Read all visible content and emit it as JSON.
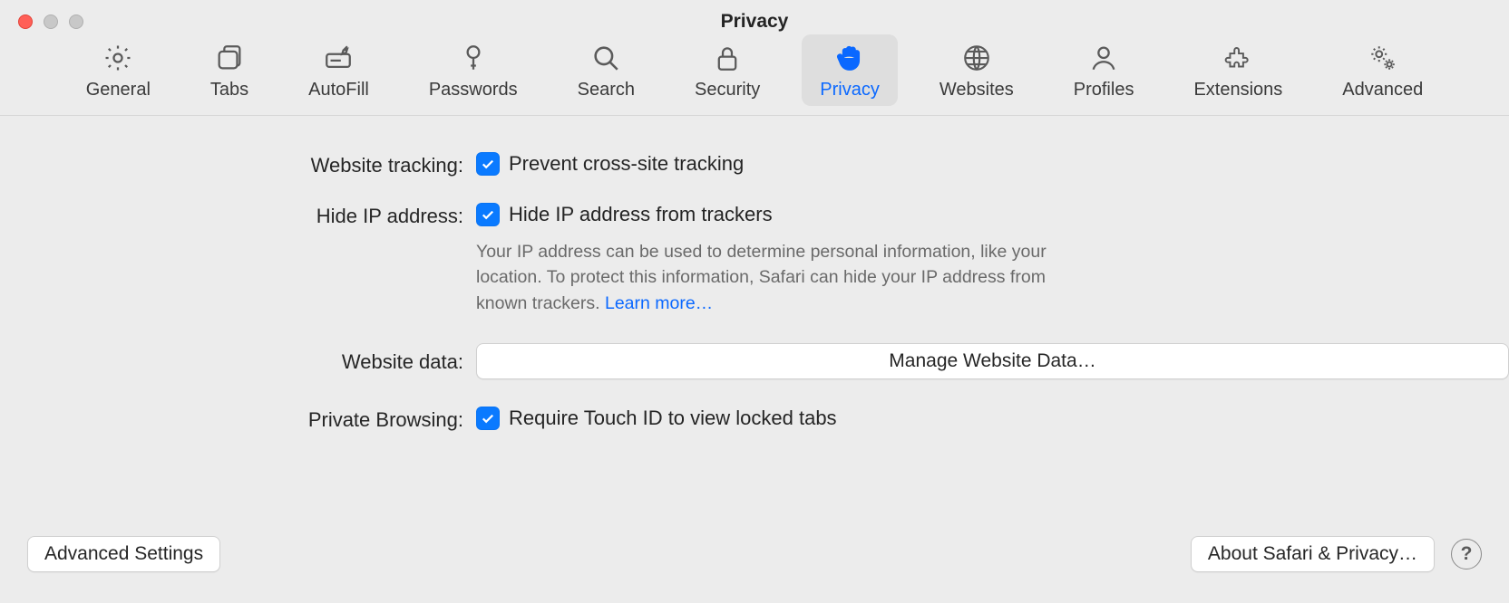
{
  "window": {
    "title": "Privacy"
  },
  "toolbar": {
    "items": [
      {
        "label": "General"
      },
      {
        "label": "Tabs"
      },
      {
        "label": "AutoFill"
      },
      {
        "label": "Passwords"
      },
      {
        "label": "Search"
      },
      {
        "label": "Security"
      },
      {
        "label": "Privacy"
      },
      {
        "label": "Websites"
      },
      {
        "label": "Profiles"
      },
      {
        "label": "Extensions"
      },
      {
        "label": "Advanced"
      }
    ]
  },
  "rows": {
    "website_tracking": {
      "label": "Website tracking:",
      "checkbox_label": "Prevent cross-site tracking",
      "checked": true
    },
    "hide_ip": {
      "label": "Hide IP address:",
      "checkbox_label": "Hide IP address from trackers",
      "checked": true,
      "help": "Your IP address can be used to determine personal information, like your location. To protect this information, Safari can hide your IP address from known trackers. ",
      "learn_more": "Learn more…"
    },
    "website_data": {
      "label": "Website data:",
      "button": "Manage Website Data…"
    },
    "private_browsing": {
      "label": "Private Browsing:",
      "checkbox_label": "Require Touch ID to view locked tabs",
      "checked": true
    }
  },
  "footer": {
    "advanced_settings": "Advanced Settings",
    "about": "About Safari & Privacy…",
    "help": "?"
  }
}
